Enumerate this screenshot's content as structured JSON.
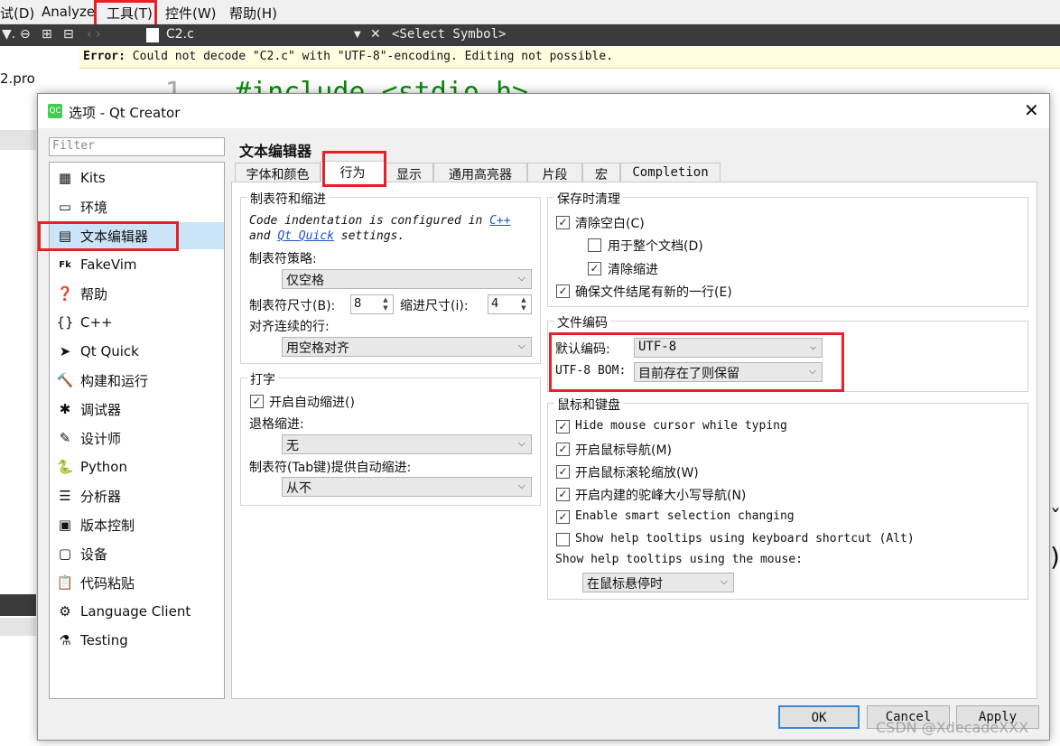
{
  "menubar": {
    "items": [
      "试(D)",
      "Analyze",
      "工具(T)",
      "控件(W)",
      "帮助(H)"
    ]
  },
  "editor": {
    "file_name": "C2.c",
    "symbol_placeholder": "<Select Symbol>",
    "error_label": "Error:",
    "error_text": "Could not decode \"C2.c\" with \"UTF-8\"-encoding. Editing not possible.",
    "line_number": "1",
    "code_line": "#include <stdio.h>",
    "project_item": "2.pro"
  },
  "dialog": {
    "title": "选项 - Qt Creator",
    "filter_placeholder": "Filter",
    "sidebar": [
      {
        "icon": "kits-icon",
        "glyph": "▦",
        "label": "Kits"
      },
      {
        "icon": "monitor-icon",
        "glyph": "▭",
        "label": "环境"
      },
      {
        "icon": "text-editor-icon",
        "glyph": "▤",
        "label": "文本编辑器"
      },
      {
        "icon": "fakevim-icon",
        "glyph": "Fk",
        "label": "FakeVim"
      },
      {
        "icon": "help-icon",
        "glyph": "❓",
        "label": "帮助"
      },
      {
        "icon": "cpp-icon",
        "glyph": "{}",
        "label": "C++"
      },
      {
        "icon": "qtquick-icon",
        "glyph": "➤",
        "label": "Qt Quick"
      },
      {
        "icon": "build-run-icon",
        "glyph": "🔨",
        "label": "构建和运行"
      },
      {
        "icon": "debugger-icon",
        "glyph": "✱",
        "label": "调试器"
      },
      {
        "icon": "designer-icon",
        "glyph": "✎",
        "label": "设计师"
      },
      {
        "icon": "python-icon",
        "glyph": "🐍",
        "label": "Python"
      },
      {
        "icon": "analyzer-icon",
        "glyph": "☰",
        "label": "分析器"
      },
      {
        "icon": "version-control-icon",
        "glyph": "▣",
        "label": "版本控制"
      },
      {
        "icon": "devices-icon",
        "glyph": "▢",
        "label": "设备"
      },
      {
        "icon": "code-paste-icon",
        "glyph": "📋",
        "label": "代码粘贴"
      },
      {
        "icon": "language-client-icon",
        "glyph": "⚙",
        "label": "Language Client"
      },
      {
        "icon": "testing-icon",
        "glyph": "⚗",
        "label": "Testing"
      }
    ],
    "page_title": "文本编辑器",
    "tabs": [
      "字体和颜色",
      "行为",
      "显示",
      "通用高亮器",
      "片段",
      "宏",
      "Completion"
    ],
    "tabs_indent": {
      "group_title": "制表符和缩进",
      "note_part1": "Code indentation is configured in",
      "note_link1": "C++",
      "note_part2": "and",
      "note_link2": "Qt Quick",
      "note_part3": "settings.",
      "tab_policy_label": "制表符策略:",
      "tab_policy_value": "仅空格",
      "tab_size_label": "制表符尺寸(B):",
      "tab_size_value": "8",
      "indent_size_label": "缩进尺寸(i):",
      "indent_size_value": "4",
      "align_label": "对齐连续的行:",
      "align_value": "用空格对齐"
    },
    "typing": {
      "group_title": "打字",
      "auto_indent_label": "开启自动缩进()",
      "backspace_label": "退格缩进:",
      "backspace_value": "无",
      "tab_key_label": "制表符(Tab键)提供自动缩进:",
      "tab_key_value": "从不"
    },
    "cleanup": {
      "group_title": "保存时清理",
      "clean_whitespace": "清除空白(C)",
      "entire_doc": "用于整个文档(D)",
      "clean_indent": "清除缩进",
      "newline_end": "确保文件结尾有新的一行(E)"
    },
    "encoding": {
      "group_title": "文件编码",
      "default_label": "默认编码:",
      "default_value": "UTF-8",
      "bom_label": "UTF-8 BOM:",
      "bom_value": "目前存在了则保留"
    },
    "mouse": {
      "group_title": "鼠标和键盘",
      "opt1": "Hide mouse cursor while typing",
      "opt2": "开启鼠标导航(M)",
      "opt3": "开启鼠标滚轮缩放(W)",
      "opt4": "开启内建的驼峰大小写导航(N)",
      "opt5": "Enable smart selection changing",
      "opt6": "Show help tooltips using keyboard shortcut (Alt)",
      "tooltip_label": "Show help tooltips using the mouse:",
      "tooltip_value": "在鼠标悬停时"
    },
    "buttons": {
      "ok": "OK",
      "cancel": "Cancel",
      "apply": "Apply"
    }
  },
  "watermark": "CSDN @XdecadeXXX",
  "colors": {
    "highlight_red": "#e8202a",
    "selection_blue": "#cce4f7",
    "link_blue": "#1a55c9"
  }
}
